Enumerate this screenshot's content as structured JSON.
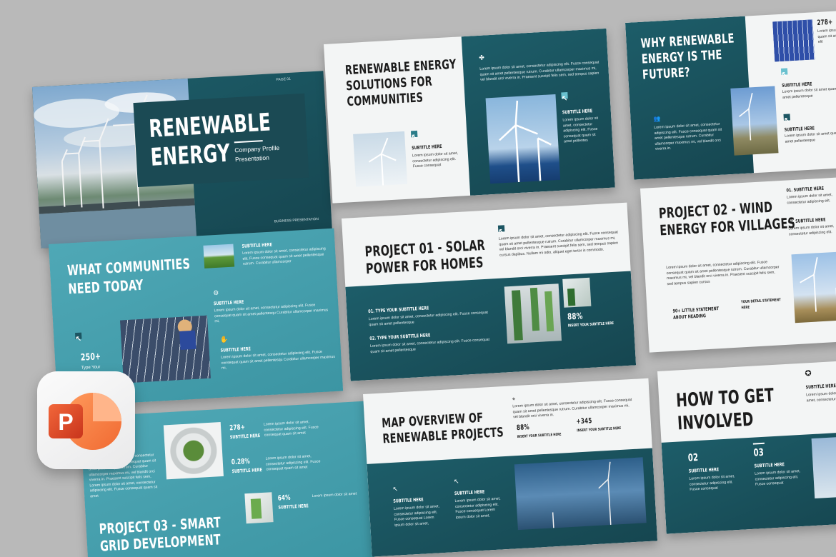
{
  "slide1": {
    "page": "PAGE 01",
    "title_line1": "RENEWABLE",
    "title_line2": "ENERGY",
    "subtitle_line1": "Company Profile",
    "subtitle_line2": "Presentation",
    "footer": "BUSINESS PRESENTATION"
  },
  "slide2": {
    "title_line1": "RENEWABLE ENERGY",
    "title_line2": "SOLUTIONS FOR",
    "title_line3": "COMMUNITIES",
    "sub_left": "SUBTITLE HERE",
    "text_left": "Lorem ipsum dolor sit amet, consectetur adipiscing elit. Fusce consequat",
    "text_top": "Lorem ipsum dolor sit amet, consectetur adipiscing elit. Fusce consequat quam sit amet pellentesque rutrum. Curabitur ullamcorper maximus mi, vel blandit orci viverra in. Praesent suscipit felis sem, sed tempus sapien",
    "sub_right": "SUBTITLE HERE",
    "text_right": "Lorem ipsum dolor sit amet, consectetur adipiscing elit. Fusce consequat quam sit amet pellentes"
  },
  "slide3": {
    "title_line1": "WHY RENEWABLE",
    "title_line2": "ENERGY IS THE",
    "title_line3": "FUTURE?",
    "text_left": "Lorem ipsum dolor sit amet, consectetur adipiscing elit. Fusce consequat quam sit amet pellentesque rutrum. Curabitur ullamcorper maximus mi, vel blandit orci viverra in.",
    "stat": "278+",
    "stat_text": "Lorem ipsum quam sit amet elit",
    "sub1": "SUBTITLE HERE",
    "text1": "Lorem ipsum dolor sit amet quam sit amet pellentesque",
    "sub2": "SUBTITLE HERE",
    "text2": "Lorem ipsum dolor sit amet quam sit amet pellentesque"
  },
  "slide4": {
    "title_line1": "WHAT COMMUNITIES",
    "title_line2": "NEED TODAY",
    "sub_a": "SUBTITLE HERE",
    "text_a": "Lorem ipsum dolor sit amet, consectetur adipiscing elit. Fusce consequat quam sit amet pellentesque rutrum. Curabitur ullamcorper",
    "sub_b": "SUBTITLE HERE",
    "text_b": "Lorem ipsum dolor sit amet, consectetur adipiscing elit. Fusce consequat quam sit amet pellentesqu Curabitur ullamcorper maximus mi,",
    "sub_c": "SUBTITLE HERE",
    "text_c": "Lorem ipsum dolor sit amet, consectetur adipiscing elit. Fusce consequat quam sit amet pellentesqu Curabitur ullamcorper maximus mi,",
    "stat": "250+",
    "stat_label": "Type Your"
  },
  "slide5": {
    "title_line1": "PROJECT 01 - SOLAR",
    "title_line2": "POWER FOR HOMES",
    "text_top": "Lorem ipsum dolor sit amet, consectetur adipiscing elit. Fusce consequat quam sit amet pellentesque rutrum. Curabitur ullamcorper maximus mi, vel blandit orci viverra in. Praesent suscipit felis sem, sed tempus sapien cursus dapibus. Nullam mi odio, aliquet eget tortor is commodo.",
    "item1_title": "01. TYPE YOUR SUBTITLE HERE",
    "item1_text": "Lorem ipsum dolor sit amet, consectetur adipiscing elit. Fusce consequat quam sit amet pellentesque",
    "item2_title": "02. TYPE YOUR SUBTITLE HERE",
    "item2_text": "Lorem ipsum dolor sit amet, consectetur adipiscing elit. Fusce consequat quam sit amet pellentesque",
    "stat": "88%",
    "stat_label": "INSERT YOUR SUBTITLE HERE"
  },
  "slide6": {
    "title_line1": "PROJECT 02 - WIND",
    "title_line2": "ENERGY FOR VILLAGES",
    "item1_title": "01. SUBTITLE HERE",
    "item1_text": "Lorem ipsum dolor sit amet, consectetur adipiscing elit.",
    "item2_title": "02. SUBTITLE HERE",
    "item2_text": "Lorem ipsum dolor sit amet, consectetur adipiscing elit.",
    "text_main": "Lorem ipsum dolor sit amet, consectetur adipiscing elit. Fusce consequat quam sit amet pellentesque rutrum. Curabitur ullamcorper maximus mi, vel blandit orci viverra in. Praesent suscipit felis sem, sed tempus sapien cursus",
    "stat_a": "90+ LITTLE STATEMENT",
    "stat_a2": "ABOUT HEADING",
    "stat_b": "YOUR DETAIL STATEMENT",
    "stat_b2": "HERE"
  },
  "slide7": {
    "stat1": "278+",
    "stat1_sub": "SUBTITLE HERE",
    "stat1_text": "Lorem ipsum dolor sit amet, consectetur adipiscing elit. Fusce consequat quam sit amet",
    "stat2": "0.28%",
    "stat2_sub": "SUBTITLE HERE",
    "stat2_text": "Lorem ipsum dolor sit amet, consectetur adipiscing elit. Fusce consequat quam sit amet",
    "stat3": "64%",
    "stat3_sub": "SUBTITLE HERE",
    "stat3_text": "Lorem ipsum dolor sit amet",
    "text_left": "Lorem ipsum dolor sit amet, consectetur adipiscing elit. Fusce consequat quam sit amet pellentesque rutrum. Curabitur ullamcorper maximus mi, vel blandit orci viverra in. Praesent suscipit felis sem, Lorem ipsum dolor sit amet, consectetur adipiscing elit. Fusce consequat quam sit amet",
    "title_line1": "PROJECT 03 - SMART",
    "title_line2": "GRID DEVELOPMENT"
  },
  "slide8": {
    "title_line1": "MAP OVERVIEW OF",
    "title_line2": "RENEWABLE PROJECTS",
    "text_top": "Lorem ipsum dolor sit amet, consectetur adipiscing elit. Fusce consequat quam sit amet pellentesque rutrum. Curabitur ullamcorper maximus mi, vel blandit orci viverra in.",
    "stat1": "88%",
    "stat1_label": "INSERT YOUR SUBTITLE HERE",
    "stat2": "+345",
    "stat2_label": "INSERT YOUR SUBTITLE HERE",
    "sub1": "SUBTITLE HERE",
    "text1": "Lorem ipsum dolor sit amet, consectetur adipiscing elit. Fusce consequat Lorem ipsum dolor sit amet,",
    "sub2": "SUBTITLE HERE",
    "text2": "Lorem ipsum dolor sit amet, consectetur adipiscing elit. Fusce consequat Lorem ipsum dolor sit amet,"
  },
  "slide9": {
    "title_line1": "HOW TO GET",
    "title_line2": "INVOLVED",
    "sub_top": "SUBTITLE HERE",
    "text_top": "Lorem ipsum dolor sit amet, consectetur",
    "n1": "02",
    "n1_sub": "SUBTITLE HERE",
    "n1_text": "Lorem ipsum dolor sit amet, consectetur adipiscing elit. Fusce consequat",
    "n2": "03",
    "n2_sub": "SUBTITLE HERE",
    "n2_text": "Lorem ipsum dolor sit amet, consectetur adipiscing elit. Fusce consequat"
  },
  "colors": {
    "dark_teal": "#1a5561",
    "teal": "#4aa3b1",
    "light": "#f3f5f5",
    "ppt_orange": "#e8532f"
  },
  "icons": [
    "powerpoint-icon",
    "arrow-icon",
    "wind-turbine-icon",
    "award-icon"
  ]
}
